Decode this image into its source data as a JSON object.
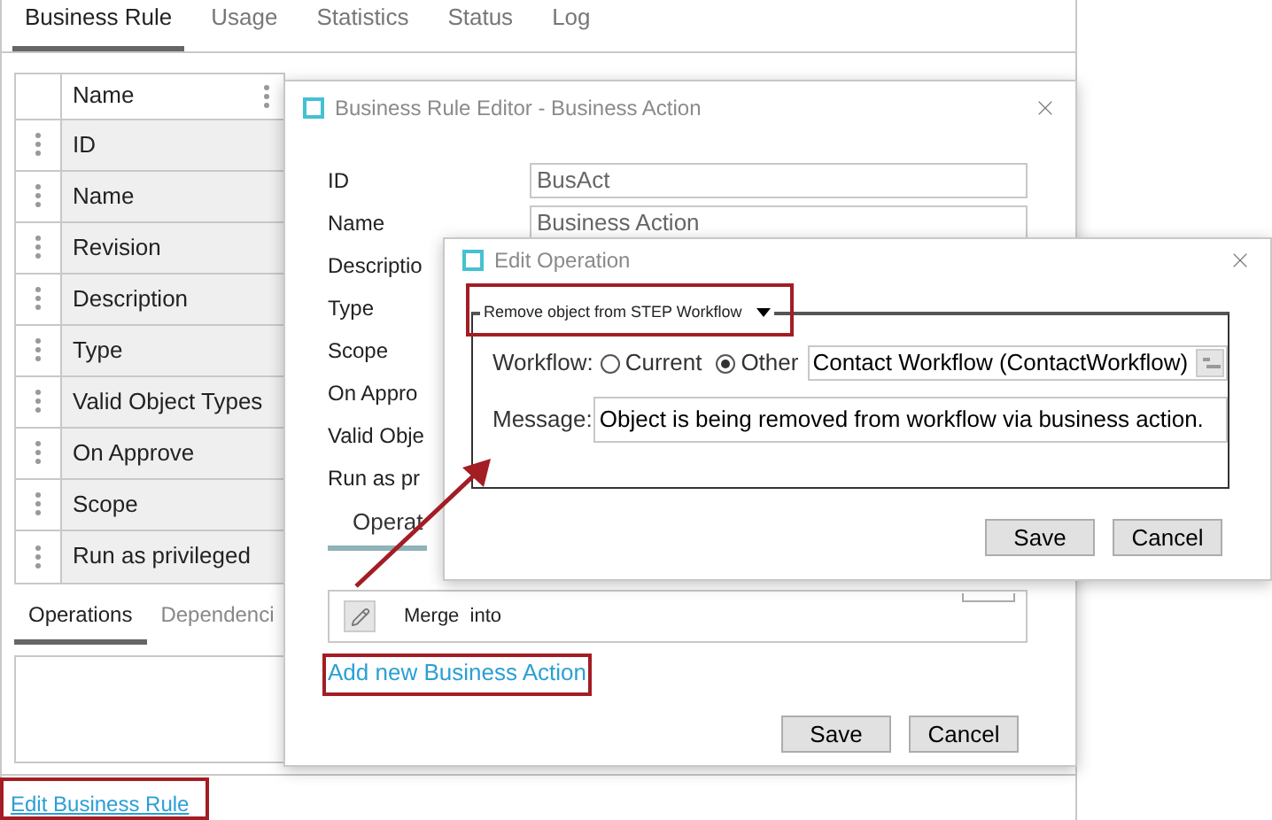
{
  "tabs": [
    {
      "label": "Business Rule",
      "selected": true
    },
    {
      "label": "Usage",
      "selected": false
    },
    {
      "label": "Statistics",
      "selected": false
    },
    {
      "label": "Status",
      "selected": false
    },
    {
      "label": "Log",
      "selected": false
    }
  ],
  "properties_table": {
    "column": "Name",
    "rows": [
      "ID",
      "Name",
      "Revision",
      "Description",
      "Type",
      "Valid Object Types",
      "On Approve",
      "Scope",
      "Run as privileged"
    ]
  },
  "bottom_tabs": [
    {
      "label": "Operations",
      "selected": true
    },
    {
      "label": "Dependenci",
      "selected": false
    }
  ],
  "edit_link": "Edit Business Rule",
  "editor_dialog": {
    "title": "Business Rule Editor - Business Action",
    "rows": [
      {
        "label": "ID",
        "value": "BusAct"
      },
      {
        "label": "Name",
        "value": "Business Action"
      },
      {
        "label": "Descriptio"
      },
      {
        "label": "Type"
      },
      {
        "label": "Scope"
      },
      {
        "label": "On Appro"
      },
      {
        "label": "Valid Obje"
      },
      {
        "label": "Run as pr"
      }
    ],
    "section_tab": "Operat",
    "operations": [
      "Merge  into"
    ],
    "add_link": "Add new Business Action",
    "buttons": [
      "Save",
      "Cancel"
    ]
  },
  "operation_dialog": {
    "title": "Edit Operation",
    "operation": "Remove object from STEP Workflow",
    "workflow": {
      "label": "Workflow:",
      "options": [
        {
          "label": "Current",
          "selected": false
        },
        {
          "label": "Other",
          "selected": true
        }
      ],
      "value": "Contact Workflow (ContactWorkflow)"
    },
    "message": {
      "label": "Message:",
      "value": "Object is being removed from workflow via business action."
    },
    "buttons": [
      "Save",
      "Cancel"
    ]
  }
}
